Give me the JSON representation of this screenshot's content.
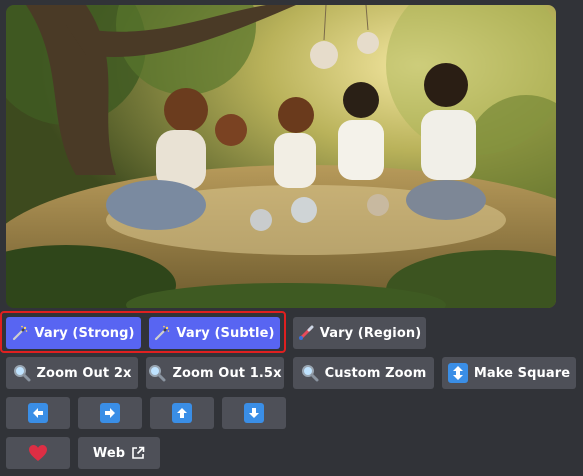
{
  "image": {
    "description_icon": "image-preview"
  },
  "buttons": {
    "vary_strong": {
      "label": "Vary (Strong)",
      "icon": "magic-wand-icon"
    },
    "vary_subtle": {
      "label": "Vary (Subtle)",
      "icon": "magic-wand-icon"
    },
    "vary_region": {
      "label": "Vary (Region)",
      "icon": "paintbrush-icon"
    },
    "zoom_out_2x": {
      "label": "Zoom Out 2x",
      "icon": "magnifier-icon"
    },
    "zoom_out_15x": {
      "label": "Zoom Out 1.5x",
      "icon": "magnifier-icon"
    },
    "custom_zoom": {
      "label": "Custom Zoom",
      "icon": "magnifier-icon"
    },
    "make_square": {
      "label": "Make Square",
      "icon": "up-down-arrow-icon"
    },
    "pan_left": {
      "icon": "arrow-left-icon"
    },
    "pan_right": {
      "icon": "arrow-right-icon"
    },
    "pan_up": {
      "icon": "arrow-up-icon"
    },
    "pan_down": {
      "icon": "arrow-down-icon"
    },
    "favorite": {
      "icon": "heart-icon"
    },
    "web": {
      "label": "Web",
      "icon": "external-link-icon"
    }
  },
  "colors": {
    "background": "#313338",
    "primary_button": "#5865f2",
    "secondary_button": "#4e5058",
    "highlight_border": "#e02020",
    "arrow_blue": "#3a8ee6",
    "heart_red": "#dd2e44"
  }
}
